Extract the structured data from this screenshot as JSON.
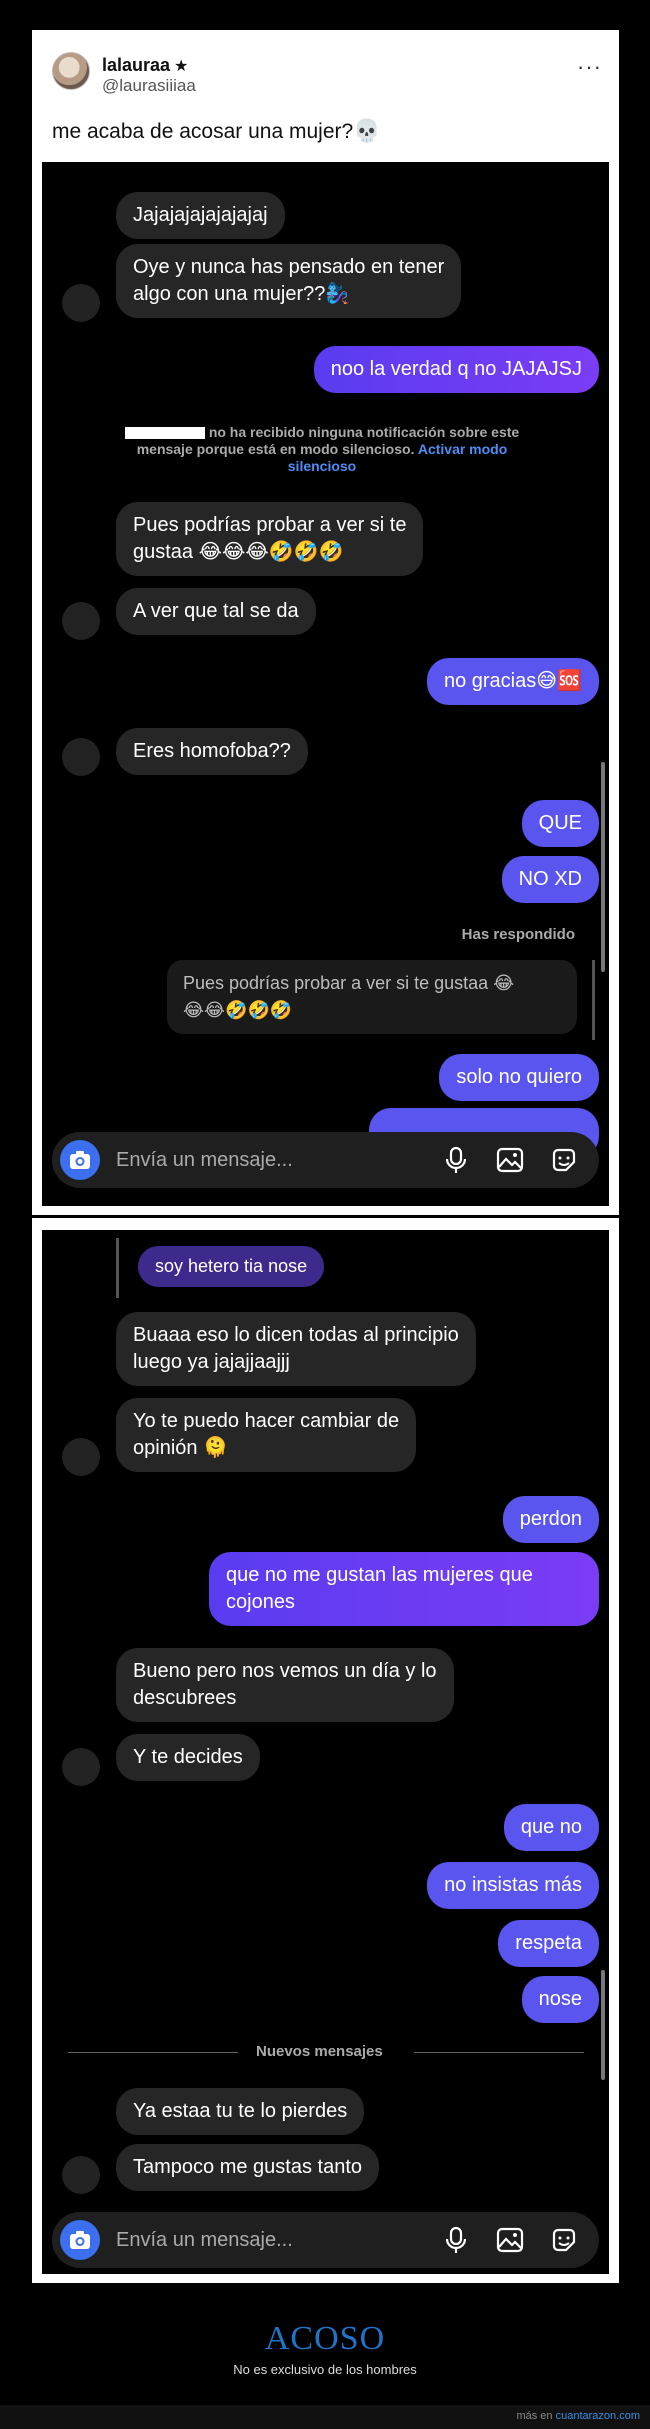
{
  "tweet": {
    "name": "lalauraa",
    "star": "★",
    "handle": "@laurasiiiaa",
    "more": "···",
    "text": "me acaba de acosar una mujer?",
    "emoji": "💀"
  },
  "chat1": {
    "messages": [
      {
        "dir": "in",
        "text": "Jajajajajajajajaj"
      },
      {
        "dir": "in",
        "text": "Oye y nunca has pensado en tener\nalgo con una mujer??🧞‍♀️"
      },
      {
        "dir": "out",
        "text": "noo la verdad q no JAJAJSJ"
      },
      {
        "dir": "in",
        "text": "Pues podrías probar a ver si te\ngustaa 😂😂😂🤣🤣🤣"
      },
      {
        "dir": "in",
        "text": "A ver que tal se da"
      },
      {
        "dir": "out",
        "text": "no gracias😅🆘"
      },
      {
        "dir": "in",
        "text": "Eres homofoba??"
      },
      {
        "dir": "out",
        "text": "QUE"
      },
      {
        "dir": "out",
        "text": "NO XD"
      },
      {
        "dir": "out",
        "text": "solo no quiero"
      }
    ],
    "system_notice": "no ha recibido ninguna notificación sobre este mensaje porque está en modo silencioso.",
    "system_link": "Activar modo silencioso",
    "replied_label": "Has respondido",
    "quoted_text": "Pues podrías probar a ver si te gustaa 😂\n😂😂🤣🤣🤣"
  },
  "chat2": {
    "reply_quote": "soy hetero tia nose",
    "messages": [
      {
        "dir": "in",
        "text": "Buaaa eso lo dicen todas al principio\nluego ya jajajjaajjj"
      },
      {
        "dir": "in",
        "text": "Yo te puedo hacer cambiar de\nopinión 🫠"
      },
      {
        "dir": "out",
        "text": "perdon"
      },
      {
        "dir": "out",
        "text": "que no me gustan las mujeres que\ncojones"
      },
      {
        "dir": "in",
        "text": "Bueno pero nos vemos un día y lo\ndescubrees"
      },
      {
        "dir": "in",
        "text": "Y te decides"
      },
      {
        "dir": "out",
        "text": "que no"
      },
      {
        "dir": "out",
        "text": "no insistas más"
      },
      {
        "dir": "out",
        "text": "respeta"
      },
      {
        "dir": "out",
        "text": "nose"
      },
      {
        "dir": "in",
        "text": "Ya estaa tu te lo pierdes"
      },
      {
        "dir": "in",
        "text": "Tampoco me gustas tanto"
      }
    ],
    "new_messages": "Nuevos mensajes"
  },
  "composer": {
    "placeholder": "Envía un mensaje..."
  },
  "footer": {
    "title": "ACOSO",
    "subtitle": "No es exclusivo de los hombres",
    "source_prefix": "más en",
    "source_site": "cuantarazon.com"
  },
  "colors": {
    "outgoing": "#6a3cf3",
    "incoming": "#262626",
    "link": "#4d8ef5",
    "footer_title": "#1e74c9"
  }
}
